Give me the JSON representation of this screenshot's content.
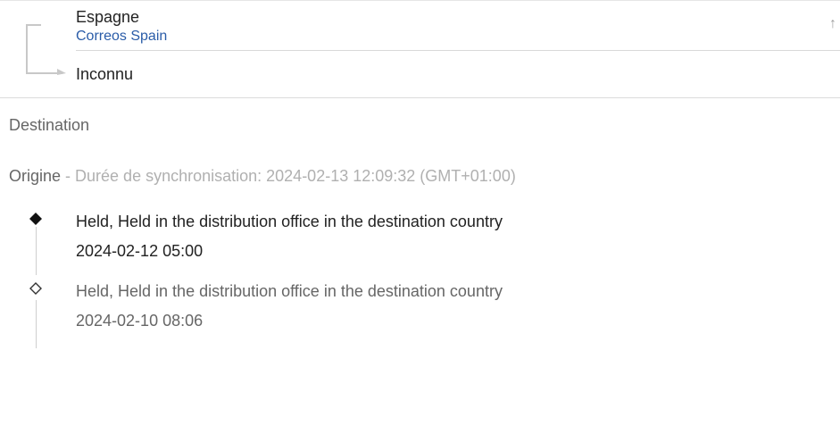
{
  "shipment": {
    "origin_country": "Espagne",
    "carrier": "Correos Spain",
    "destination_country": "Inconnu"
  },
  "icons": {
    "route": "route-arrow-icon",
    "collapse": "arrow-up-icon"
  },
  "sections": {
    "destination_label": "Destination",
    "origin_label": "Origine",
    "sync_text": " - Durée de synchronisation: 2024-02-13 12:09:32 (GMT+01:00)"
  },
  "events": [
    {
      "status": "Held, Held in the distribution office in the destination country",
      "datetime": "2024-02-12 05:00",
      "marker": "filled-diamond-icon"
    },
    {
      "status": "Held, Held in the distribution office in the destination country",
      "datetime": "2024-02-10 08:06",
      "marker": "outline-diamond-icon"
    }
  ],
  "colors": {
    "carrier_link": "#2a5ca8",
    "primary_text": "#222222",
    "secondary_text": "#666666",
    "muted_text": "#b0b0b0"
  }
}
